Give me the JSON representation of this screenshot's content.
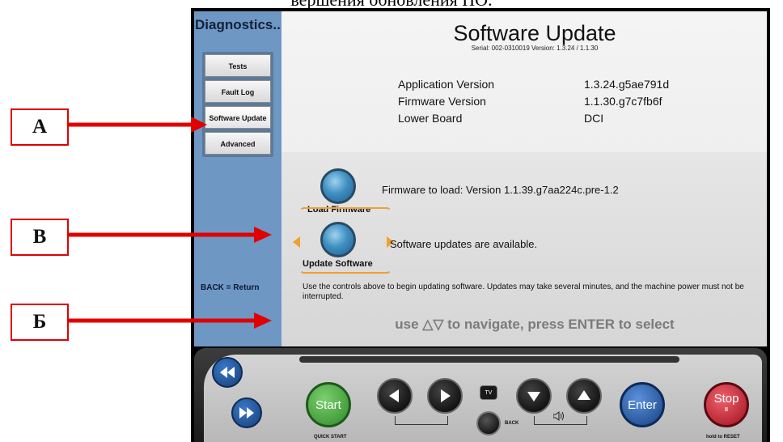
{
  "top_caption": "вершения обновления ПО.",
  "sidebar": {
    "title": "Diagnostics...",
    "items": [
      {
        "label": "Tests"
      },
      {
        "label": "Fault Log"
      },
      {
        "label": "Software Update"
      },
      {
        "label": "Advanced"
      }
    ],
    "back_hint": "BACK = Return"
  },
  "main": {
    "title": "Software Update",
    "serial": "Serial: 002-0310019  Version: 1.3.24 / 1.1.30",
    "info": [
      {
        "label": "Application Version",
        "value": "1.3.24.g5ae791d"
      },
      {
        "label": "Firmware Version",
        "value": "1.1.30.g7c7fb6f"
      },
      {
        "label": "Lower Board",
        "value": "DCI"
      }
    ],
    "load_firmware_label": "Load Firmware",
    "firmware_text": "Firmware to load: Version 1.1.39.g7aa224c.pre-1.2",
    "update_software_label": "Update Software",
    "update_text": "Software updates are available.",
    "help_text": "Use the controls above to begin updating software.  Updates may take several minutes, and the machine power must not be interrupted.",
    "nav_hint": "use △▽ to navigate, press ENTER to select"
  },
  "panel": {
    "start_label": "Start",
    "quick_start_label": "QUICK START",
    "back_label": "BACK",
    "tv_label": "TV",
    "enter_label": "Enter",
    "stop_label": "Stop",
    "stop_sub": "II",
    "hold_reset_label": "hold to RESET"
  },
  "callouts": {
    "a": "А",
    "v": "В",
    "b": "Б"
  },
  "colors": {
    "arrow": "#e00000",
    "selection": "#f0a030",
    "sidebar": "#6e97c4",
    "start": "#3f9a3a",
    "enter": "#1f5aa8",
    "stop": "#c0182a"
  }
}
